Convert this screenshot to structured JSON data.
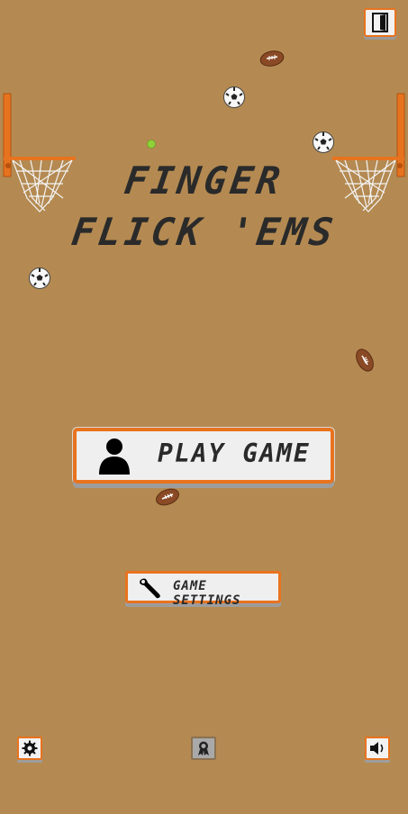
{
  "title": {
    "line1": "FINGER",
    "line2": "FLICK 'EMS"
  },
  "buttons": {
    "play": "PLAY GAME",
    "settings": "GAME SETTINGS"
  },
  "icons": {
    "exit": "door-exit-icon",
    "player": "person-silhouette-icon",
    "wrench": "wrench-icon",
    "gear": "gear-icon",
    "award": "award-ribbon-icon",
    "sound": "speaker-icon"
  },
  "colors": {
    "background": "#b48a52",
    "accent": "#e8731f",
    "button": "#efefef",
    "text": "#2a2a2a"
  }
}
